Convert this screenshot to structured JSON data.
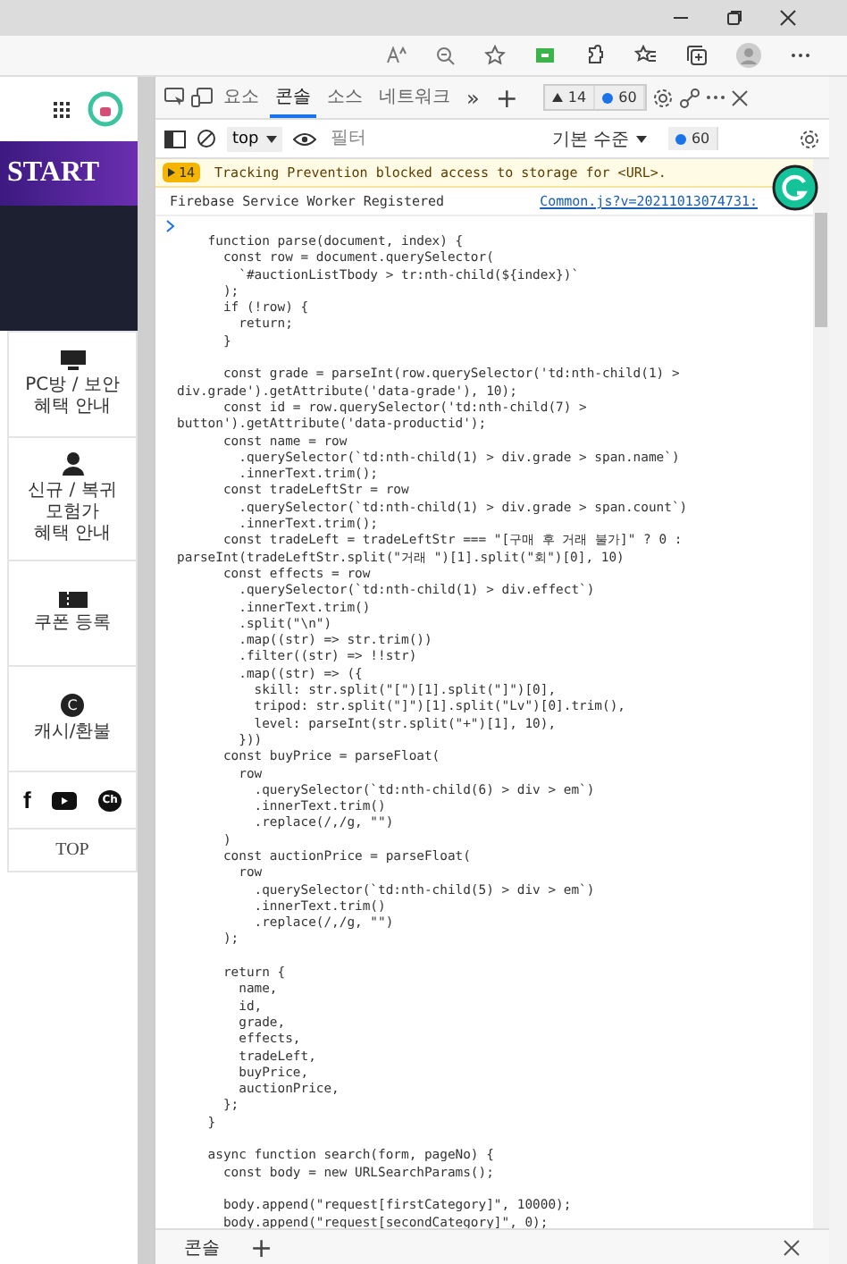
{
  "page": {
    "banner_text": "START",
    "sidebar_items": [
      {
        "label": "PC방 / 보안\n혜택 안내"
      },
      {
        "label": "신규 / 복귀\n모험가\n혜택 안내"
      },
      {
        "label": "쿠폰 등록"
      },
      {
        "label": "캐시/환불",
        "icon_text": "C"
      }
    ],
    "social": [
      {
        "kind": "letter",
        "text": "f"
      },
      {
        "kind": "play"
      },
      {
        "kind": "bubble",
        "text": "Ch"
      }
    ],
    "top_button": "TOP"
  },
  "devtools": {
    "tabs": [
      {
        "label": "요소",
        "selected": false
      },
      {
        "label": "콘솔",
        "selected": true
      },
      {
        "label": "소스",
        "selected": false
      },
      {
        "label": "네트워크",
        "selected": false
      }
    ],
    "more": "»",
    "add": "+",
    "warning_count": "14",
    "info_count": "60",
    "context": "top",
    "filter_placeholder": "필터",
    "level_select": "기본 수준",
    "toolbar_info_count": "60"
  },
  "console": {
    "messages": [
      {
        "kind": "warning",
        "count": "14",
        "text": "Tracking Prevention blocked access to storage for <URL>."
      },
      {
        "kind": "log",
        "text": "Firebase Service Worker Registered",
        "source": "Common.js?v=20211013074731:"
      }
    ],
    "code_blocks": [
      {
        "lines": [
          "    function parse(document, index) {",
          "      const row = document.querySelector(",
          "        `#auctionListTbody > tr:nth-child(${index})`",
          "      );",
          "      if (!row) {",
          "        return;",
          "      }"
        ]
      },
      {
        "lines": [
          "      const grade = parseInt(row.querySelector('td:nth-child(1) >",
          "div.grade').getAttribute('data-grade'), 10);",
          "      const id = row.querySelector('td:nth-child(7) >",
          "button').getAttribute('data-productid');",
          "      const name = row",
          "        .querySelector(`td:nth-child(1) > div.grade > span.name`)",
          "        .innerText.trim();",
          "      const tradeLeftStr = row",
          "        .querySelector(`td:nth-child(1) > div.grade > span.count`)",
          "        .innerText.trim();",
          "      const tradeLeft = tradeLeftStr === \"[구매 후 거래 불가]\" ? 0 :",
          "parseInt(tradeLeftStr.split(\"거래 \")[1].split(\"회\")[0], 10)",
          "      const effects = row",
          "        .querySelector(`td:nth-child(1) > div.effect`)",
          "        .innerText.trim()",
          "        .split(\"\\n\")",
          "        .map((str) => str.trim())",
          "        .filter((str) => !!str)",
          "        .map((str) => ({",
          "          skill: str.split(\"[\")[1].split(\"]\")[0],",
          "          tripod: str.split(\"]\")[1].split(\"Lv\")[0].trim(),",
          "          level: parseInt(str.split(\"+\")[1], 10),",
          "        }))",
          "      const buyPrice = parseFloat(",
          "        row",
          "          .querySelector(`td:nth-child(6) > div > em`)",
          "          .innerText.trim()",
          "          .replace(/,/g, \"\")",
          "      )",
          "      const auctionPrice = parseFloat(",
          "        row",
          "          .querySelector(`td:nth-child(5) > div > em`)",
          "          .innerText.trim()",
          "          .replace(/,/g, \"\")",
          "      );"
        ]
      },
      {
        "lines": [
          "      return {",
          "        name,",
          "        id,",
          "        grade,",
          "        effects,",
          "        tradeLeft,",
          "        buyPrice,",
          "        auctionPrice,",
          "      };",
          "    }"
        ]
      },
      {
        "lines": [
          "    async function search(form, pageNo) {",
          "      const body = new URLSearchParams();"
        ]
      },
      {
        "lines": [
          "      body.append(\"request[firstCategory]\", 10000);",
          "      body.append(\"request[secondCategory]\", 0);"
        ]
      }
    ]
  },
  "drawer": {
    "tab": "콘솔",
    "add": "+"
  }
}
